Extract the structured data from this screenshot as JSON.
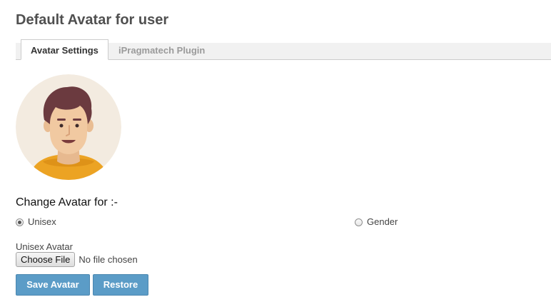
{
  "page": {
    "title": "Default Avatar for user"
  },
  "tabs": [
    {
      "label": "Avatar Settings",
      "active": true
    },
    {
      "label": "iPragmatech Plugin",
      "active": false
    }
  ],
  "avatar": {
    "icon": "male-avatar-icon",
    "colors": {
      "background": "#f3ebe0",
      "hair": "#6b3a3f",
      "skin": "#f1c9a1",
      "shirt": "#eca323"
    }
  },
  "form": {
    "heading": "Change Avatar for :-",
    "radios": [
      {
        "label": "Unisex",
        "checked": true
      },
      {
        "label": "Gender",
        "checked": false
      }
    ],
    "file_label": "Unisex Avatar",
    "choose_button": "Choose File",
    "file_status": "No file chosen"
  },
  "actions": {
    "save_label": "Save Avatar",
    "restore_label": "Restore",
    "button_color": "#5b9cc7"
  }
}
